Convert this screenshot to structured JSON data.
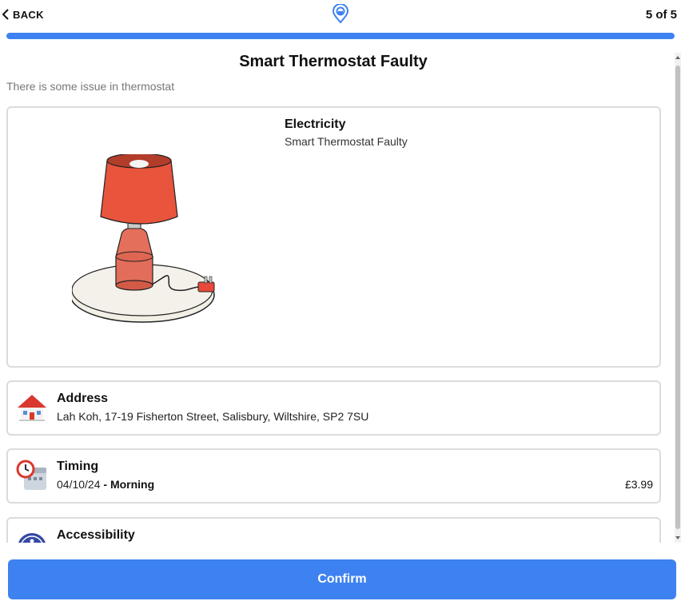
{
  "header": {
    "back_label": "BACK",
    "step_text": "5 of 5",
    "progress": 1.0,
    "accent_color": "#3d82f0"
  },
  "issue": {
    "title": "Smart Thermostat Faulty",
    "description": "There is some issue in thermostat",
    "category": "Electricity",
    "subcategory": "Smart Thermostat Faulty",
    "illustration": "table-lamp"
  },
  "address": {
    "icon": "house-icon",
    "heading": "Address",
    "value": "Lah Koh, 17-19 Fisherton Street, Salisbury, Wiltshire, SP2 7SU"
  },
  "timing": {
    "icon": "clock-calendar-icon",
    "heading": "Timing",
    "date": "04/10/24",
    "separator": " - ",
    "slot": "Morning",
    "price": "£3.99"
  },
  "accessibility": {
    "icon": "accessibility-icon",
    "heading": "Accessibility"
  },
  "footer": {
    "confirm_label": "Confirm"
  }
}
